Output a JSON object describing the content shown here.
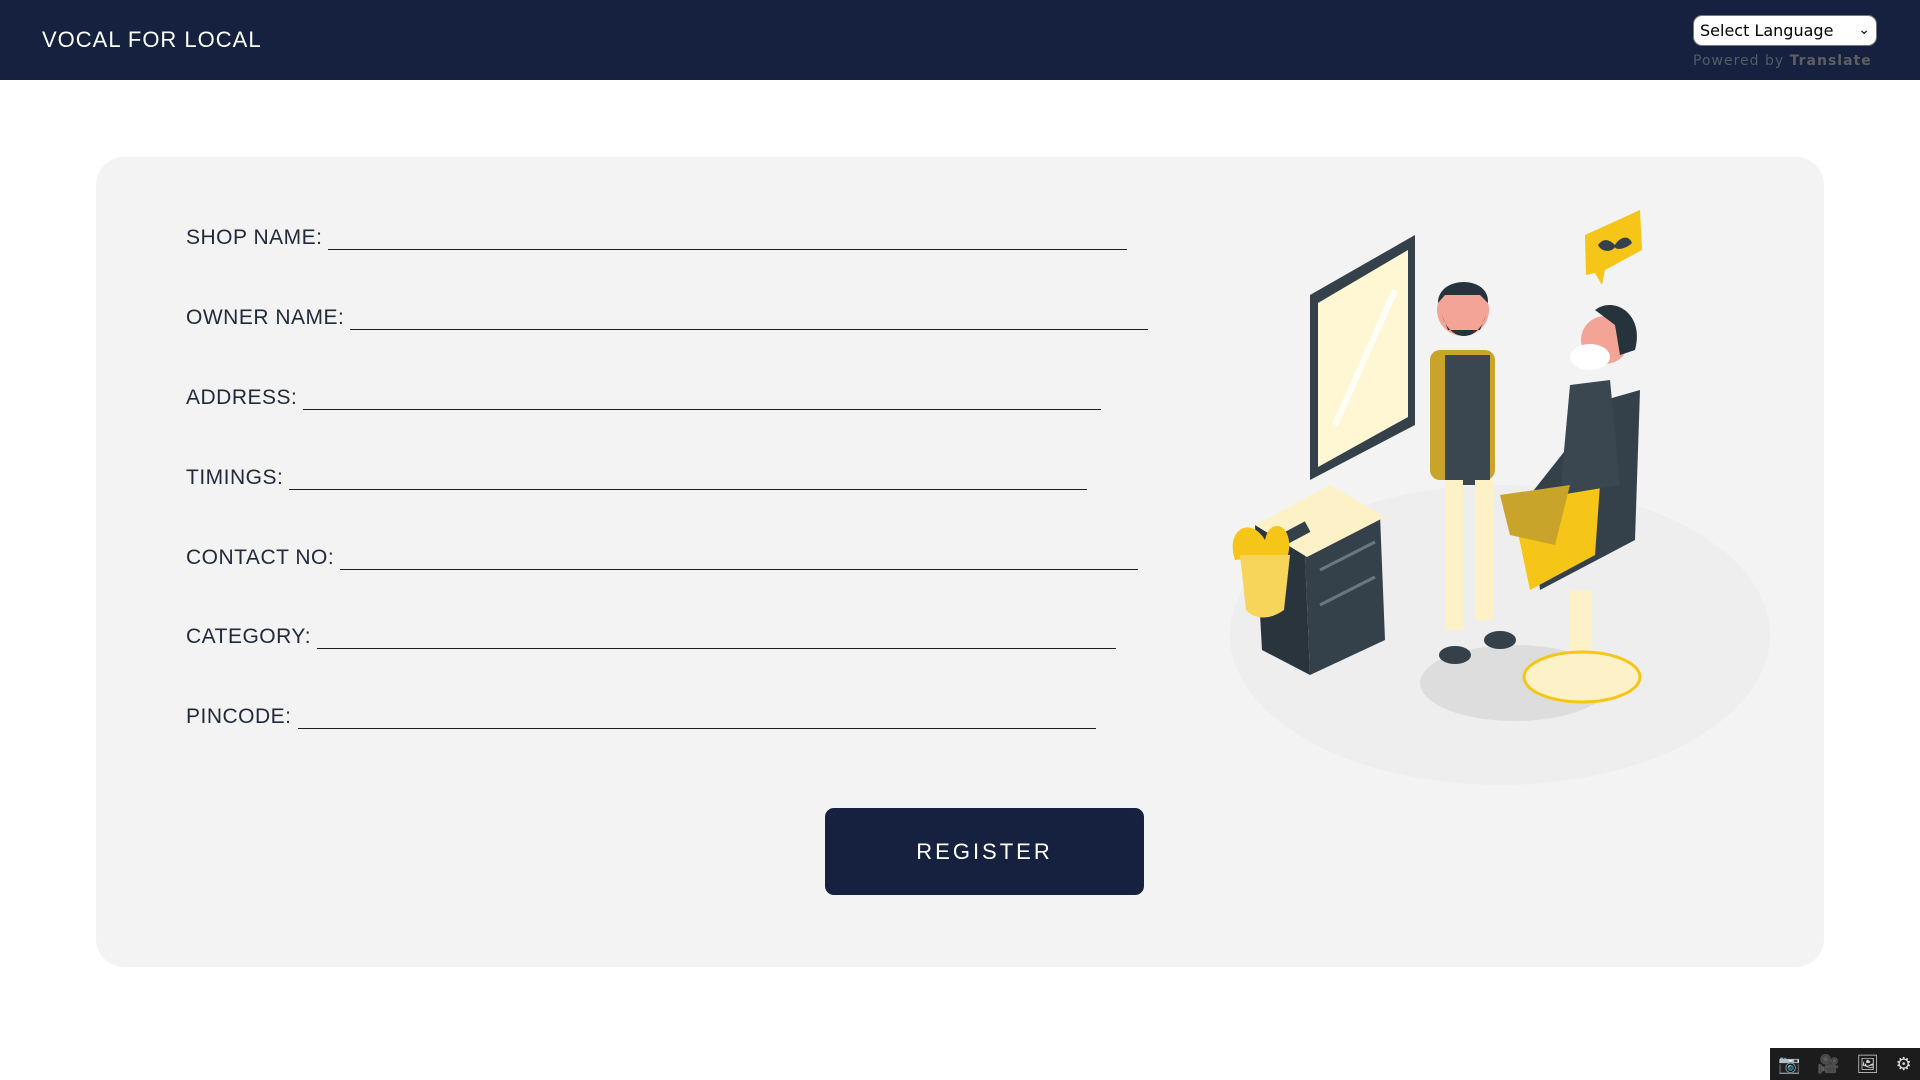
{
  "header": {
    "brand": "VOCAL FOR LOCAL",
    "language_select": {
      "value": "Select Language",
      "chevron_icon": "chevron-down-icon"
    },
    "powered_by": "Powered by",
    "powered_by_brand": "Translate"
  },
  "form": {
    "fields": [
      {
        "label": "SHOP NAME:",
        "value": ""
      },
      {
        "label": "OWNER NAME:",
        "value": ""
      },
      {
        "label": "ADDRESS:",
        "value": ""
      },
      {
        "label": "TIMINGS:",
        "value": ""
      },
      {
        "label": "CONTACT NO:",
        "value": ""
      },
      {
        "label": "CATEGORY:",
        "value": ""
      },
      {
        "label": "PINCODE:",
        "value": ""
      }
    ],
    "submit_label": "REGISTER"
  },
  "illustration": {
    "icon": "barber-shop-illustration"
  },
  "toolbar": {
    "icons": [
      "camera-icon",
      "video-icon",
      "image-icon",
      "gear-icon"
    ],
    "glyphs": [
      "📷",
      "🎥",
      "🖼",
      "⚙"
    ]
  },
  "colors": {
    "navy": "#15213e",
    "card": "#f3f3f3",
    "accent_yellow": "#f5c518"
  }
}
